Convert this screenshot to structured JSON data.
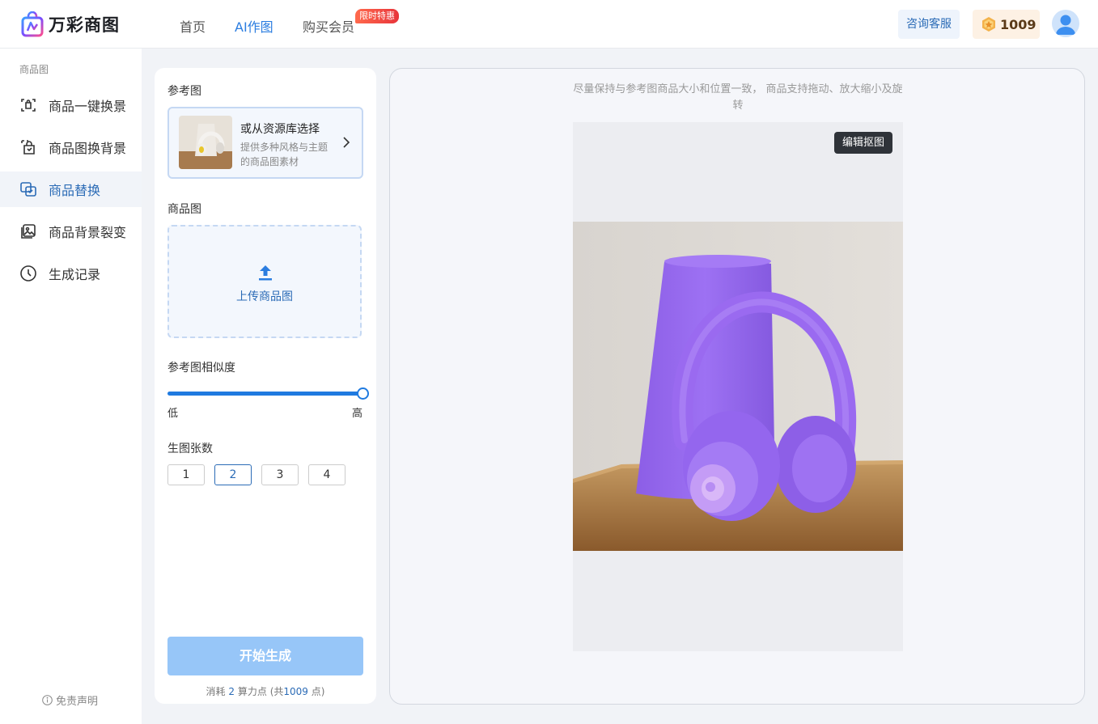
{
  "header": {
    "brand": "万彩商图",
    "nav": [
      {
        "label": "首页",
        "active": false
      },
      {
        "label": "AI作图",
        "active": true
      },
      {
        "label": "购买会员",
        "active": false
      }
    ],
    "promo_badge": "限时特惠",
    "consult_label": "咨询客服",
    "points": "1009"
  },
  "sidebar": {
    "section_title": "商品图",
    "items": [
      {
        "label": "商品一键换景",
        "icon": "scene-swap-icon"
      },
      {
        "label": "商品图换背景",
        "icon": "bag-background-icon"
      },
      {
        "label": "商品替换",
        "icon": "product-replace-icon",
        "active": true
      },
      {
        "label": "商品背景裂变",
        "icon": "image-variants-icon"
      },
      {
        "label": "生成记录",
        "icon": "clock-icon"
      }
    ],
    "disclaimer": "免责声明"
  },
  "panel": {
    "reference_label": "参考图",
    "reference_card": {
      "title": "或从资源库选择",
      "description": "提供多种风格与主题的商品图素材"
    },
    "product_label": "商品图",
    "upload_label": "上传商品图",
    "similarity_label": "参考图相似度",
    "similarity_value": 1.0,
    "similarity_low": "低",
    "similarity_high": "高",
    "count_label": "生图张数",
    "count_options": [
      "1",
      "2",
      "3",
      "4"
    ],
    "count_selected": "2",
    "generate_label": "开始生成",
    "cost": {
      "prefix": "消耗",
      "amount": "2",
      "unit": "算力点",
      "total_prefix": "(共",
      "total": "1009",
      "total_suffix": "点)"
    }
  },
  "canvas": {
    "hint": "尽量保持与参考图商品大小和位置一致， 商品支持拖动、放大缩小及旋转",
    "edit_button": "编辑抠图"
  },
  "colors": {
    "accent": "#2b7de0",
    "product_purple": "#9a6af0",
    "generate_disabled": "#97c6f8"
  }
}
